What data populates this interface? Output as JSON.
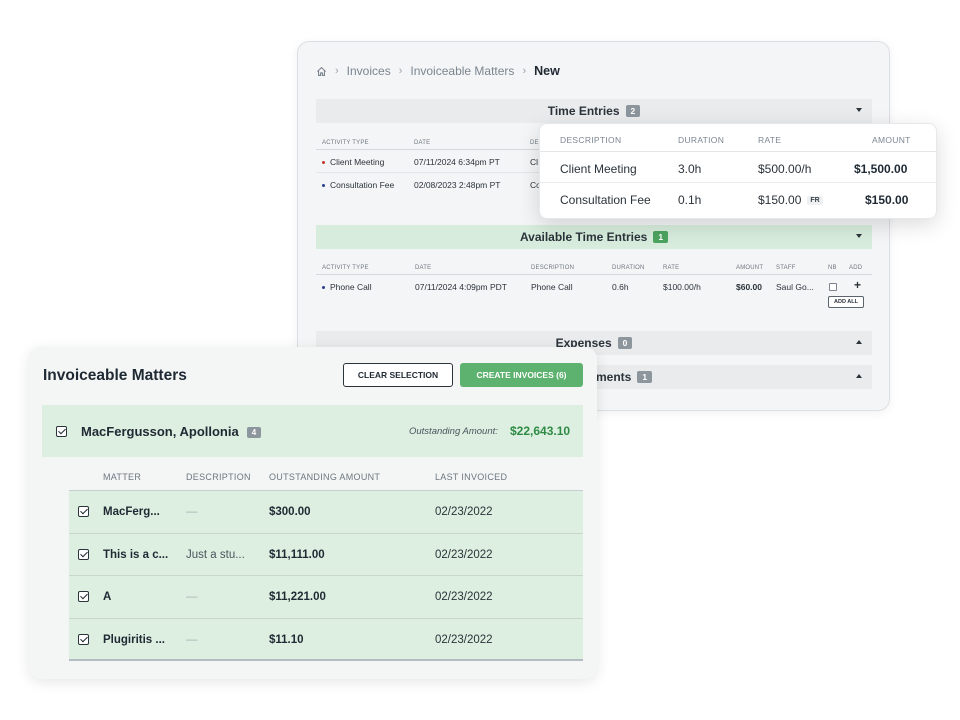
{
  "breadcrumb": {
    "home_icon": "home-icon",
    "items": [
      "Invoices",
      "Invoiceable Matters"
    ],
    "current": "New"
  },
  "time_entries": {
    "title": "Time Entries",
    "count": "2",
    "columns": [
      "ACTIVITY TYPE",
      "DATE",
      "DE"
    ],
    "rows": [
      {
        "activity": "Client Meeting",
        "date": "07/11/2024 6:34pm PT",
        "desc": "Cl",
        "dot_color": "#c0392b"
      },
      {
        "activity": "Consultation Fee",
        "date": "02/08/2023 2:48pm PT",
        "desc": "Co",
        "dot_color": "#2c3e8f"
      }
    ]
  },
  "popup": {
    "columns": [
      "DESCRIPTION",
      "DURATION",
      "RATE",
      "AMOUNT"
    ],
    "rows": [
      {
        "description": "Client Meeting",
        "duration": "3.0h",
        "rate": "$500.00/h",
        "badge": "",
        "amount": "$1,500.00"
      },
      {
        "description": "Consultation Fee",
        "duration": "0.1h",
        "rate": "$150.00",
        "badge": "FR",
        "amount": "$150.00"
      }
    ]
  },
  "available_time_entries": {
    "title": "Available Time Entries",
    "count": "1",
    "columns": [
      "ACTIVITY TYPE",
      "DATE",
      "DESCRIPTION",
      "DURATION",
      "RATE",
      "AMOUNT",
      "STAFF",
      "NB",
      "ADD"
    ],
    "rows": [
      {
        "activity": "Phone Call",
        "date": "07/11/2024 4:09pm PDT",
        "description": "Phone Call",
        "duration": "0.6h",
        "rate": "$100.00/h",
        "amount": "$60.00",
        "staff": "Saul Go...",
        "dot_color": "#2c3e8f",
        "add": "+"
      }
    ],
    "add_all_label": "ADD ALL"
  },
  "expenses": {
    "title": "Expenses",
    "count": "0"
  },
  "adjustments": {
    "title": "ments",
    "count": "1"
  },
  "invoiceable": {
    "title": "Invoiceable Matters",
    "clear_label": "CLEAR SELECTION",
    "create_label": "CREATE INVOICES (6)",
    "client": {
      "name": "MacFergusson, Apollonia",
      "count": "4",
      "outstanding_label": "Outstanding Amount:",
      "outstanding_value": "$22,643.10"
    },
    "columns": [
      "MATTER",
      "DESCRIPTION",
      "OUTSTANDING AMOUNT",
      "LAST INVOICED"
    ],
    "rows": [
      {
        "matter": "MacFerg...",
        "description": "—",
        "amount": "$300.00",
        "last_invoiced": "02/23/2022"
      },
      {
        "matter": "This is a c...",
        "description": "Just a stu...",
        "amount": "$11,111.00",
        "last_invoiced": "02/23/2022"
      },
      {
        "matter": "A",
        "description": "—",
        "amount": "$11,221.00",
        "last_invoiced": "02/23/2022"
      },
      {
        "matter": "Plugiritis ...",
        "description": "—",
        "amount": "$11.10",
        "last_invoiced": "02/23/2022"
      }
    ]
  },
  "colors": {
    "accent_green": "#5db26f",
    "row_green": "#dcefe0",
    "outstanding_green": "#2f8a45"
  }
}
